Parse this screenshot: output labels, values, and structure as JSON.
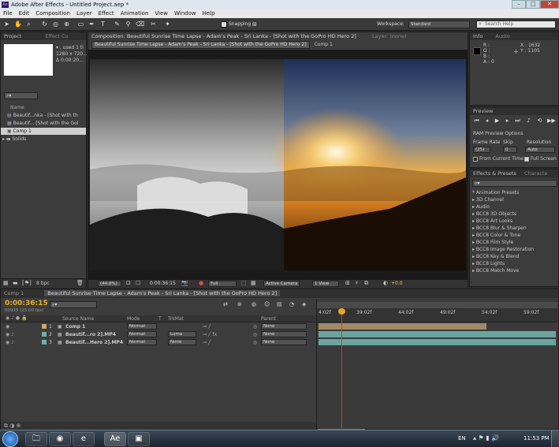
{
  "window": {
    "title": "Adobe After Effects - Untitled Project.aep *",
    "min": "–",
    "max": "□",
    "close": "✕",
    "logo": "Ae"
  },
  "menu": [
    "File",
    "Edit",
    "Composition",
    "Layer",
    "Effect",
    "Animation",
    "View",
    "Window",
    "Help"
  ],
  "toolbar": {
    "snapping_label": "Snapping",
    "workspace_label": "Workspace:",
    "workspace_value": "Standard",
    "search_placeholder": "Search Help"
  },
  "project": {
    "tab_project": "Project",
    "tab_effect": "Effect Co",
    "meta_line1": "▾ , used 1 ti",
    "meta_line2": "1280 x 720...",
    "meta_line3": "Δ 0:00:20...",
    "col_name": "Name",
    "items": [
      "Beautif...nka - [Shot with th",
      "Beautif... [Shot with the Gol",
      "Comp 1",
      "Solids"
    ],
    "bpc": "8 bpc"
  },
  "comp": {
    "tab": "Composition: Beautiful Sunrise Time Lapse - Adam's Peak - Sri Lanka - [Shot with the GoPro HD Hero 2]",
    "layer_tab": "Layer: (none)",
    "breadcrumb1": "Beautiful Sunrise Time Lapse - Adam's Peak - Sri Lanka - [Shot with the GoPro HD Hero 2]",
    "breadcrumb2": "Comp 1",
    "zoom": "(44.8%)",
    "timecode": "0:00:36:15",
    "resolution": "Full",
    "camera": "Active Camera",
    "views": "1 View",
    "exposure": "+0.0"
  },
  "info": {
    "tab_info": "Info",
    "tab_audio": "Audio",
    "r": "R :",
    "g": "G :",
    "b": "B :",
    "a": "A : 0",
    "x": "X : 1632",
    "y": "Y : 1105"
  },
  "preview": {
    "tab": "Preview",
    "ram_label": "RAM Preview Options",
    "frame_rate_label": "Frame Rate",
    "skip_label": "Skip",
    "resolution_label": "Resolution",
    "frame_rate_value": "(25)",
    "skip_value": "0",
    "resolution_value": "Auto",
    "from_current": "From Current Time",
    "full_screen": "Full Screen"
  },
  "effects": {
    "tab": "Effects & Presets",
    "tab2": "Characte",
    "items": [
      "* Animation Presets",
      "3D Channel",
      "Audio",
      "BCC8 3D Objects",
      "BCC8 Art Looks",
      "BCC8 Blur & Sharpen",
      "BCC8 Color & Tone",
      "BCC8 Film Style",
      "BCC8 Image Restoration",
      "BCC8 Key & Blend",
      "BCC8 Lights",
      "BCC8 Match Move"
    ]
  },
  "timeline": {
    "tab_comp1": "Comp 1",
    "tab_main": "Beautiful Sunrise Time Lapse - Adam's Peak - Sri Lanka - [Shot with the GoPro HD Hero 2]",
    "timecode": "0:00:36:15",
    "fps": "00915 (25.00 fps)",
    "col_source": "Source Name",
    "col_mode": "Mode",
    "col_t": "T",
    "col_trkmat": "TrkMat",
    "col_parent": "Parent",
    "ruler": [
      "4:02f",
      "39:02f",
      "44:02f",
      "49:02f",
      "54:02f",
      "59:02f"
    ],
    "layers": [
      {
        "num": "1",
        "name": "Comp 1",
        "mode": "Normal",
        "trkmat": "",
        "parent": "None"
      },
      {
        "num": "2",
        "name": "Beautif...ro 2].MP4",
        "mode": "Normal",
        "trkmat": "Luma",
        "parent": "None"
      },
      {
        "num": "3",
        "name": "Beautif...Hero 2].MP4",
        "mode": "Normal",
        "trkmat": "None",
        "parent": "None"
      }
    ]
  },
  "taskbar": {
    "lang": "EN",
    "time": "11:53 PM"
  }
}
